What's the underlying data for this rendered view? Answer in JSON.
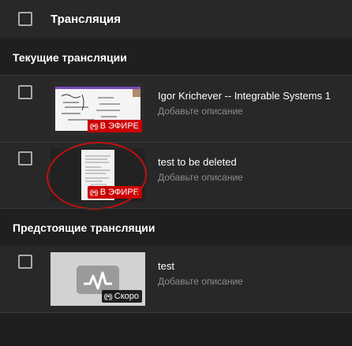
{
  "header": {
    "title": "Трансляция"
  },
  "sections": {
    "current_title": "Текущие трансляции",
    "upcoming_title": "Предстоящие трансляции"
  },
  "streams": [
    {
      "title": "Igor Krichever -- Integrable Systems 1",
      "description": "Добавьте описание",
      "badge": "В ЭФИРЕ",
      "badge_icon": "live-broadcast-icon"
    },
    {
      "title": "test to be deleted",
      "description": "Добавьте описание",
      "badge": "В ЭФИРЕ",
      "badge_icon": "live-broadcast-icon"
    },
    {
      "title": "test",
      "description": "Добавьте описание",
      "badge": "Скоро",
      "badge_icon": "live-broadcast-icon"
    }
  ],
  "colors": {
    "live_badge": "#cc0000",
    "background": "#1f1f1f",
    "row": "#282828",
    "annotation": "#c01010"
  }
}
